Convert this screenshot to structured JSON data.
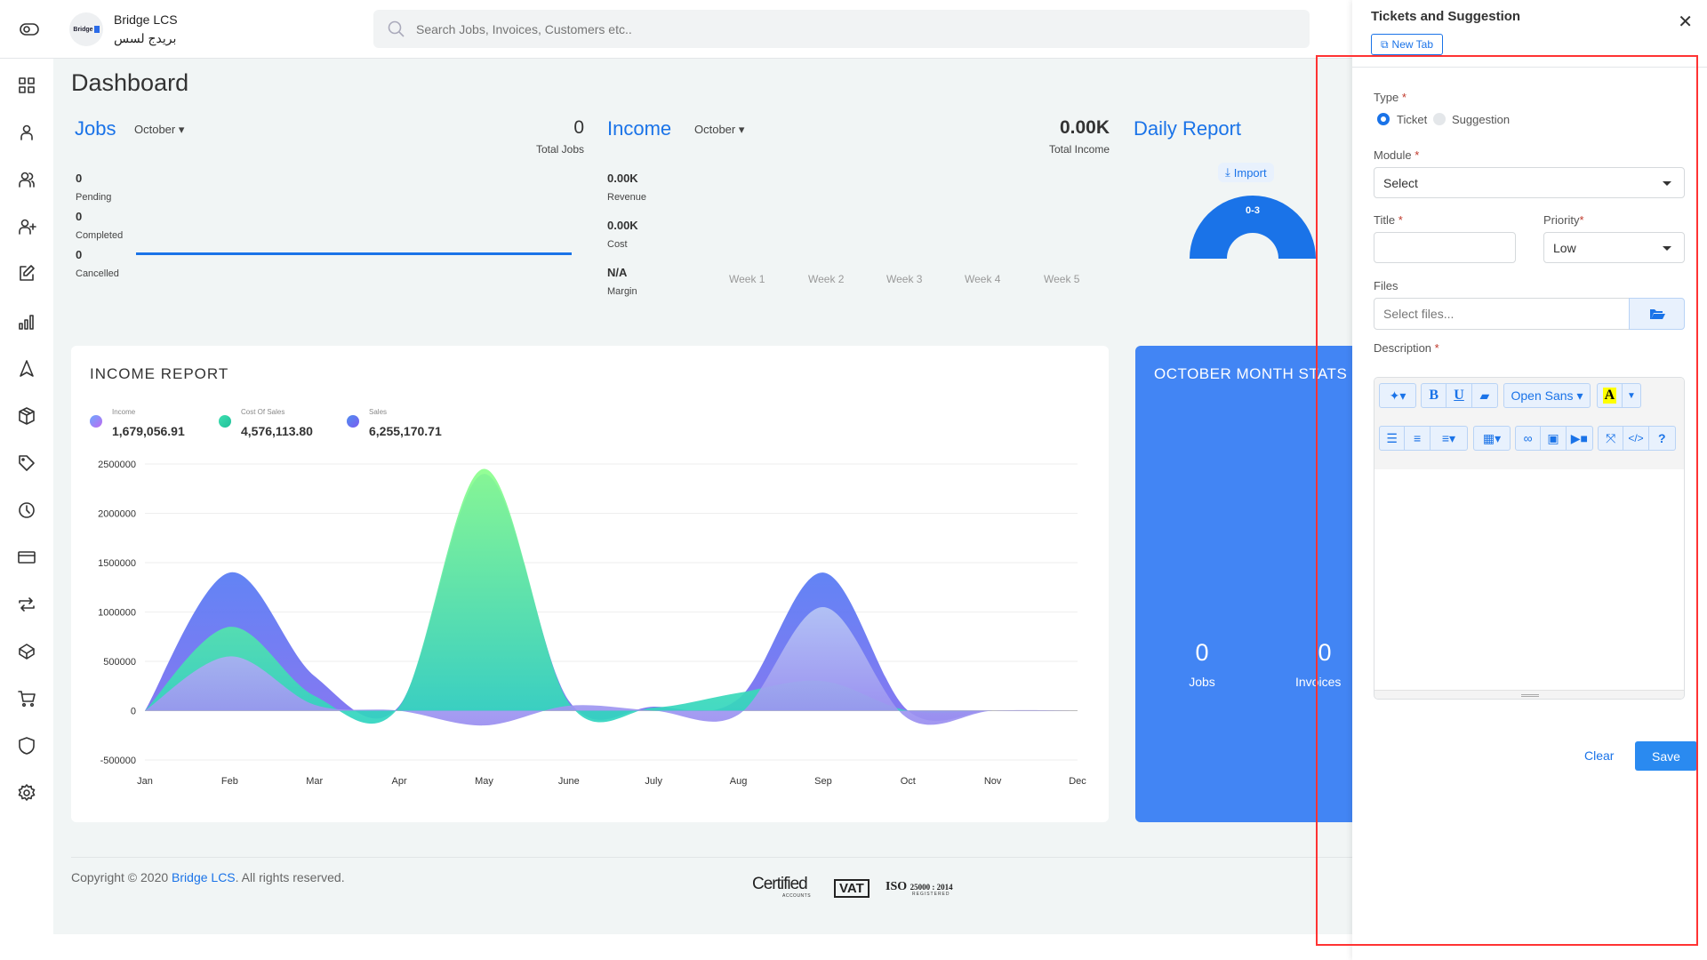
{
  "header": {
    "brand": "Bridge LCS",
    "brand_arabic": "بريدج لسس",
    "logo_text": "Bridge",
    "search_placeholder": "Search Jobs, Invoices, Customers etc.."
  },
  "sidebar": {
    "items": [
      "dashboard",
      "customer",
      "customers",
      "add-user",
      "edit",
      "reports",
      "navigation",
      "package",
      "tag",
      "clock",
      "card",
      "transfer",
      "box",
      "cart",
      "shield",
      "settings"
    ]
  },
  "page": {
    "title": "Dashboard"
  },
  "jobs": {
    "title": "Jobs",
    "month": "October",
    "total": "0",
    "total_label": "Total Jobs",
    "stats": [
      {
        "value": "0",
        "label": "Pending"
      },
      {
        "value": "0",
        "label": "Completed"
      },
      {
        "value": "0",
        "label": "Cancelled"
      }
    ]
  },
  "income": {
    "title": "Income",
    "month": "October",
    "total": "0.00K",
    "total_label": "Total Income",
    "stats": [
      {
        "value": "0.00K",
        "label": "Revenue"
      },
      {
        "value": "0.00K",
        "label": "Cost"
      },
      {
        "value": "N/A",
        "label": "Margin"
      }
    ],
    "weeks": [
      "Week 1",
      "Week 2",
      "Week 3",
      "Week 4",
      "Week 5"
    ]
  },
  "daily_report": {
    "title": "Daily Report",
    "import_label": "Import",
    "gauge_label": "0-3",
    "color": "#1a73e8"
  },
  "income_report": {
    "title": "INCOME REPORT",
    "legend": [
      {
        "label": "Income",
        "value": "1,679,056.91",
        "color": "#a78bfa"
      },
      {
        "label": "Cost Of Sales",
        "value": "4,576,113.80",
        "color": "#2dd4a7"
      },
      {
        "label": "Sales",
        "value": "6,255,170.71",
        "color": "#5b6cf5"
      }
    ]
  },
  "chart_data": {
    "type": "area",
    "categories": [
      "Jan",
      "Feb",
      "Mar",
      "Apr",
      "May",
      "June",
      "July",
      "Aug",
      "Sep",
      "Oct",
      "Nov",
      "Dec"
    ],
    "yticks": [
      "2500000",
      "2000000",
      "1500000",
      "1000000",
      "500000",
      "0",
      "-500000"
    ],
    "ylim": [
      -500000,
      2500000
    ],
    "grid": true,
    "series": [
      {
        "name": "Sales",
        "values": [
          0,
          1400000,
          350000,
          50000,
          2400000,
          100000,
          40000,
          120000,
          1400000,
          0,
          0,
          0
        ],
        "color": "#4f8ef0"
      },
      {
        "name": "Cost Of Sales",
        "values": [
          0,
          850000,
          150000,
          40000,
          2450000,
          80000,
          30000,
          180000,
          300000,
          0,
          0,
          0
        ],
        "color": "#3ee0b0"
      },
      {
        "name": "Income",
        "values": [
          0,
          550000,
          60000,
          0,
          -150000,
          50000,
          0,
          -40000,
          1050000,
          -80000,
          0,
          0
        ],
        "color": "#a9b4f0"
      }
    ]
  },
  "month_stats": {
    "title": "OCTOBER MONTH STATS",
    "items": [
      {
        "value": "0",
        "label": "Jobs"
      },
      {
        "value": "0",
        "label": "Invoices"
      }
    ]
  },
  "footer": {
    "copyright_prefix": "Copyright © 2020 ",
    "company": "Bridge LCS",
    "copyright_suffix": ". All rights reserved.",
    "badges": [
      "Certified",
      "ACCOUNTS",
      "VAT",
      "ISO",
      "25000 : 2014",
      "REGISTERED"
    ]
  },
  "panel": {
    "title": "Tickets and Suggestion",
    "new_tab": "New Tab",
    "type_label": "Type",
    "type_options": [
      "Ticket",
      "Suggestion"
    ],
    "type_selected": "Ticket",
    "module_label": "Module",
    "module_value": "Select",
    "title_label": "Title",
    "title_value": "",
    "priority_label": "Priority",
    "priority_value": "Low",
    "files_label": "Files",
    "files_placeholder": "Select files...",
    "description_label": "Description",
    "font_name": "Open Sans",
    "clear": "Clear",
    "save": "Save",
    "required": "*"
  },
  "annotation_color": "#ff3333"
}
